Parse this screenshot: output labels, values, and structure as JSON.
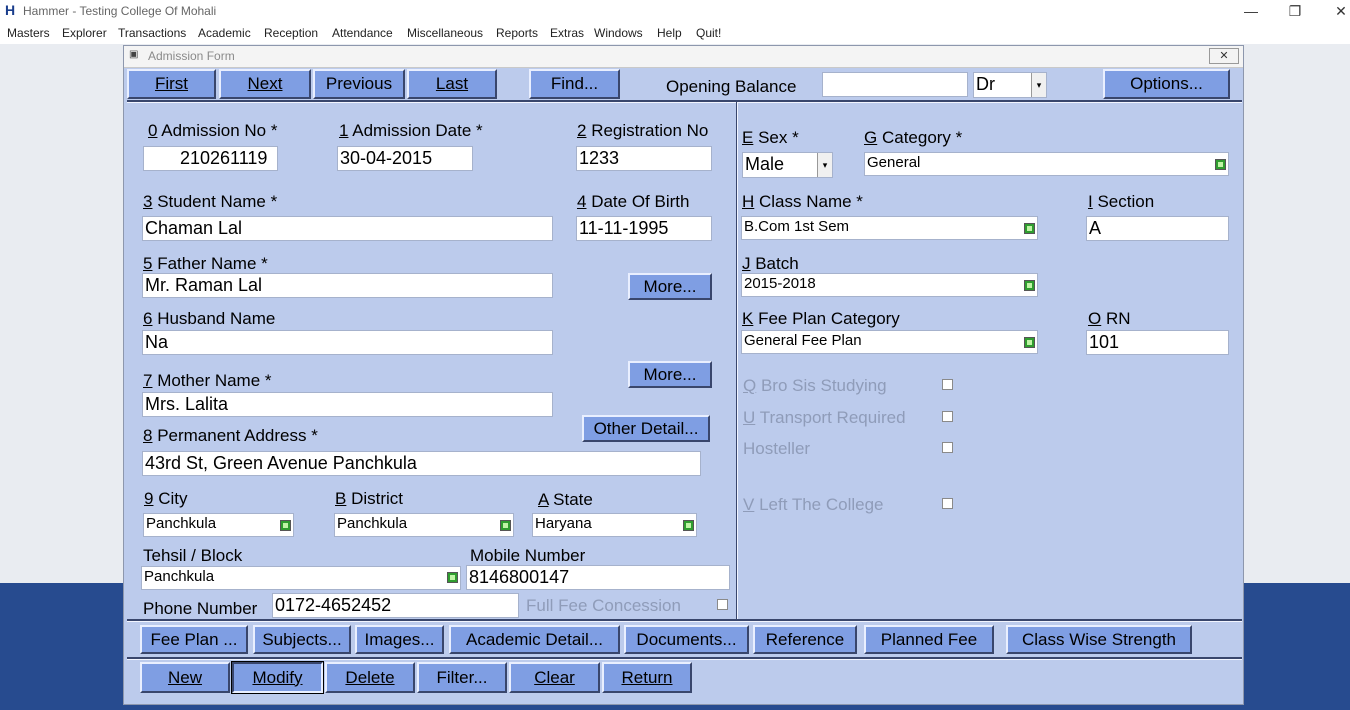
{
  "app": {
    "title": "Hammer  - Testing College Of Mohali",
    "logo": "H",
    "window_controls": {
      "minimize": "—",
      "restore": "❐",
      "close": "✕"
    }
  },
  "menu": [
    "Masters",
    "Explorer",
    "Transactions",
    "Academic",
    "Reception",
    "Attendance",
    "Miscellaneous",
    "Reports",
    "Extras",
    "Windows",
    "Help",
    "Quit!"
  ],
  "form": {
    "title": "Admission Form",
    "close": "✕",
    "nav": {
      "first": "First",
      "next": "Next",
      "previous": "Previous",
      "last": "Last",
      "find": "Find..."
    },
    "opening_balance": {
      "label": "Opening Balance",
      "value": "",
      "type": "Dr"
    },
    "options": "Options...",
    "fields": {
      "admission_no": {
        "key": "0",
        "label": " Admission No *",
        "value": "210261119"
      },
      "admission_date": {
        "key": "1",
        "label": " Admission Date *",
        "value": "30-04-2015"
      },
      "registration_no": {
        "key": "2",
        "label": " Registration No",
        "value": "1233"
      },
      "student_name": {
        "key": "3",
        "label": " Student Name *",
        "value": "Chaman Lal"
      },
      "dob": {
        "key": "4",
        "label": " Date Of Birth",
        "value": "11-11-1995"
      },
      "father_name": {
        "key": "5",
        "label": " Father Name *",
        "value": "Mr. Raman Lal"
      },
      "husband_name": {
        "key": "6",
        "label": " Husband Name",
        "value": "Na"
      },
      "mother_name": {
        "key": "7",
        "label": " Mother Name *",
        "value": "Mrs. Lalita"
      },
      "permanent_address": {
        "key": "8",
        "label": " Permanent Address *",
        "value": "43rd St, Green Avenue Panchkula"
      },
      "city": {
        "key": "9",
        "label": " City",
        "value": "Panchkula"
      },
      "district": {
        "key": "B",
        "label": " District",
        "value": "Panchkula"
      },
      "state": {
        "key": "A",
        "label": " State",
        "value": "Haryana"
      },
      "tehsil": {
        "label": "Tehsil / Block",
        "value": "Panchkula"
      },
      "mobile": {
        "label": "Mobile Number",
        "value": "8146800147"
      },
      "phone": {
        "label": "Phone Number",
        "value": "0172-4652452"
      },
      "full_fee_concession": {
        "label": "Full Fee Concession",
        "checked": false
      },
      "sex": {
        "key": "E",
        "label": " Sex *",
        "value": "Male"
      },
      "category": {
        "key": "G",
        "label": " Category *",
        "value": "General"
      },
      "class_name": {
        "key": "H",
        "label": " Class Name *",
        "value": "B.Com 1st Sem"
      },
      "section": {
        "key": "I",
        "label": " Section",
        "value": "A"
      },
      "batch": {
        "key": "J",
        "label": " Batch",
        "value": "2015-2018"
      },
      "fee_plan_category": {
        "key": "K",
        "label": " Fee Plan Category",
        "value": "General Fee Plan"
      },
      "rn": {
        "key": "O",
        "label": " RN",
        "value": "101"
      },
      "bro_sis": {
        "key": "Q",
        "label": " Bro Sis Studying",
        "checked": false
      },
      "transport": {
        "key": "U",
        "label": " Transport Required",
        "checked": false
      },
      "hosteller": {
        "label": "Hosteller",
        "checked": false
      },
      "left_college": {
        "key": "V",
        "label": " Left The College",
        "checked": false
      }
    },
    "more1": "More...",
    "more2": "More...",
    "other_detail": "Other Detail...",
    "tabs": [
      "Fee Plan ...",
      "Subjects...",
      "Images...",
      "Academic Detail...",
      "Documents...",
      "Reference",
      "Planned Fee",
      "Class Wise Strength"
    ],
    "actions": {
      "new": "New",
      "modify": "Modify",
      "delete": "Delete",
      "filter": "Filter...",
      "clear": "Clear",
      "return": "Return"
    }
  },
  "icons": {
    "picker": "lookup-icon",
    "dropdown": "chevron-down-icon",
    "dropdown_glyph": "▾"
  }
}
